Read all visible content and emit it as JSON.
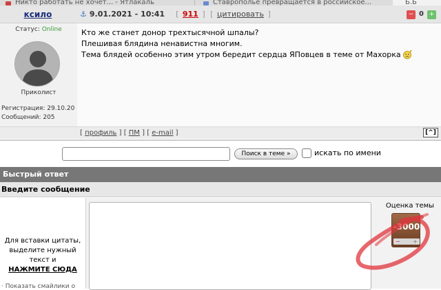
{
  "browser": {
    "tabs": [
      {
        "label": "Никто работать не хочет... - Ятлакаль"
      },
      {
        "label": "Ставрополье превращается в российское..."
      },
      {
        "label": "Б.Б"
      }
    ]
  },
  "post": {
    "author": "ксило",
    "date": "9.01.2021 - 10:41",
    "number": "911",
    "quote_label": "цитировать",
    "vote": {
      "count": "0",
      "minus_label": "−",
      "plus_label": "+"
    },
    "status_label": "Статус:",
    "status_value": "Online",
    "rank": "Приколист",
    "registered": "Регистрация: 29.10.20",
    "messages": "Сообщений: 205",
    "lines": [
      "Кто же станет донор трехтысячной шпалы?",
      "Плешивая блядина ненавистна многим.",
      "Тема блядей особенно этим утром бередит сердца ЯПовцев в теме от Махорка"
    ],
    "footer": {
      "profile": "профиль",
      "pm": "ПМ",
      "email": "e-mail",
      "up": "[^]"
    }
  },
  "search": {
    "placeholder": "",
    "button": "Поиск в теме »",
    "checkbox_label": "искать по имени"
  },
  "quick_reply": {
    "title": "Быстрый ответ",
    "subtitle": "Введите сообщение",
    "hint_text": "Для вставки цитаты, выделите нужный текст и",
    "hint_cta": "НАЖМИТЕ СЮДА",
    "smileys": "· Показать смайлики о",
    "rating_label": "Оценка темы",
    "rating_value": "-3000"
  },
  "colors": {
    "online": "#3a9a3a",
    "header_bar": "#777777",
    "scribble": "#e0343c"
  }
}
